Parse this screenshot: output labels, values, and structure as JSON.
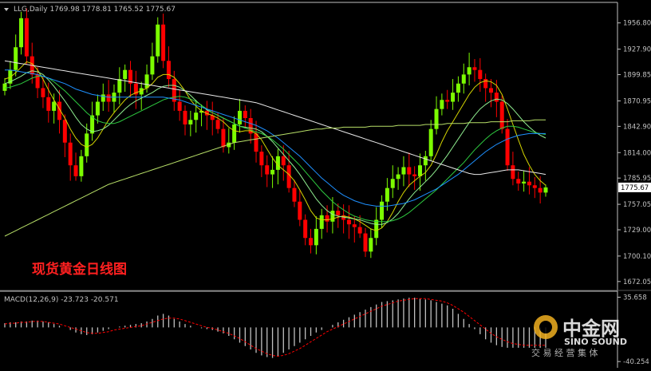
{
  "header": {
    "symbol_line": "LLG,Daily  1769.98 1778.81 1765.52 1775.67"
  },
  "annotation": "现货黄金日线图",
  "watermark": {
    "brand": "中金网",
    "brand_latin": "SINO SOUND",
    "slogan": "交 易 经 营  集 体"
  },
  "colors": {
    "background": "#000000",
    "axis": "#c0c0c0",
    "bull": "#7cfc00",
    "bear": "#ff0000",
    "ma_fast": "#d4d400",
    "ma_mid1": "#90ee90",
    "ma_mid2": "#2ecc40",
    "ma_blue": "#1e90ff",
    "ma_white": "#e8e8e8",
    "ma_long": "#b8e068",
    "macd_hist": "#c0c0c0",
    "macd_signal": "#ff0000",
    "annotation": "#ff2020"
  },
  "chart_data": [
    {
      "type": "line",
      "title": "",
      "price_axis_ticks": [
        1956.8,
        1927.9,
        1899.85,
        1870.95,
        1842.9,
        1814.0,
        1785.95,
        1757.05,
        1729.0,
        1700.1,
        1672.05
      ],
      "ylim": [
        1664,
        1975
      ],
      "current_price": 1775.67,
      "last_bar": {
        "open": 1769.98,
        "high": 1778.81,
        "low": 1765.52,
        "close": 1775.67
      },
      "close_path": [
        1890,
        1905,
        1930,
        1962,
        1920,
        1900,
        1885,
        1875,
        1860,
        1870,
        1850,
        1825,
        1800,
        1788,
        1810,
        1835,
        1855,
        1870,
        1878,
        1870,
        1880,
        1895,
        1905,
        1890,
        1878,
        1885,
        1900,
        1920,
        1955,
        1915,
        1895,
        1870,
        1860,
        1845,
        1850,
        1858,
        1860,
        1855,
        1850,
        1840,
        1820,
        1825,
        1845,
        1860,
        1852,
        1835,
        1815,
        1800,
        1790,
        1795,
        1810,
        1800,
        1775,
        1760,
        1740,
        1720,
        1712,
        1730,
        1745,
        1738,
        1750,
        1745,
        1740,
        1735,
        1732,
        1725,
        1705,
        1720,
        1740,
        1760,
        1775,
        1785,
        1790,
        1798,
        1790,
        1788,
        1800,
        1810,
        1840,
        1862,
        1872,
        1870,
        1880,
        1890,
        1900,
        1908,
        1905,
        1895,
        1885,
        1880,
        1870,
        1840,
        1800,
        1785,
        1780,
        1782,
        1778,
        1775,
        1770,
        1775
      ],
      "series": [
        {
          "key": "ma_fast",
          "values": [
            1895,
            1897,
            1902,
            1908,
            1914,
            1912,
            1905,
            1895,
            1883,
            1872,
            1862,
            1852,
            1840,
            1830,
            1823,
            1820,
            1823,
            1830,
            1840,
            1850,
            1858,
            1865,
            1872,
            1877,
            1880,
            1882,
            1885,
            1890,
            1897,
            1900,
            1900,
            1897,
            1890,
            1882,
            1872,
            1865,
            1860,
            1857,
            1855,
            1852,
            1848,
            1842,
            1838,
            1837,
            1838,
            1838,
            1835,
            1828,
            1818,
            1808,
            1800,
            1795,
            1790,
            1783,
            1773,
            1762,
            1750,
            1742,
            1740,
            1740,
            1741,
            1743,
            1744,
            1743,
            1741,
            1738,
            1734,
            1730,
            1728,
            1731,
            1738,
            1748,
            1760,
            1770,
            1778,
            1783,
            1788,
            1792,
            1800,
            1812,
            1826,
            1838,
            1848,
            1858,
            1868,
            1878,
            1886,
            1891,
            1893,
            1892,
            1888,
            1878,
            1862,
            1845,
            1828,
            1812,
            1800,
            1790,
            1783,
            1778
          ]
        },
        {
          "key": "ma_mid1",
          "values": [
            1890,
            1892,
            1895,
            1898,
            1902,
            1904,
            1903,
            1900,
            1894,
            1887,
            1879,
            1871,
            1862,
            1853,
            1845,
            1840,
            1837,
            1838,
            1840,
            1844,
            1850,
            1856,
            1862,
            1867,
            1871,
            1874,
            1877,
            1880,
            1884,
            1887,
            1888,
            1888,
            1886,
            1882,
            1877,
            1871,
            1866,
            1861,
            1858,
            1855,
            1852,
            1849,
            1846,
            1843,
            1842,
            1841,
            1840,
            1837,
            1832,
            1826,
            1819,
            1812,
            1805,
            1798,
            1790,
            1781,
            1772,
            1763,
            1756,
            1750,
            1746,
            1744,
            1743,
            1742,
            1741,
            1740,
            1738,
            1736,
            1735,
            1735,
            1737,
            1741,
            1747,
            1755,
            1763,
            1770,
            1776,
            1782,
            1788,
            1795,
            1803,
            1811,
            1820,
            1829,
            1838,
            1847,
            1855,
            1862,
            1867,
            1871,
            1873,
            1872,
            1868,
            1862,
            1855,
            1848,
            1842,
            1837,
            1833,
            1830
          ]
        },
        {
          "key": "ma_mid2",
          "values": [
            1885,
            1886,
            1888,
            1890,
            1893,
            1896,
            1898,
            1898,
            1896,
            1892,
            1887,
            1882,
            1876,
            1870,
            1864,
            1858,
            1853,
            1849,
            1847,
            1846,
            1846,
            1848,
            1851,
            1854,
            1857,
            1860,
            1863,
            1866,
            1869,
            1872,
            1874,
            1875,
            1876,
            1875,
            1873,
            1870,
            1866,
            1862,
            1858,
            1855,
            1852,
            1849,
            1846,
            1843,
            1841,
            1839,
            1837,
            1835,
            1832,
            1828,
            1823,
            1818,
            1812,
            1806,
            1800,
            1793,
            1786,
            1779,
            1772,
            1766,
            1760,
            1755,
            1751,
            1747,
            1744,
            1742,
            1740,
            1739,
            1738,
            1738,
            1738,
            1739,
            1741,
            1744,
            1748,
            1753,
            1758,
            1763,
            1768,
            1773,
            1779,
            1785,
            1791,
            1797,
            1803,
            1810,
            1817,
            1823,
            1829,
            1834,
            1838,
            1841,
            1843,
            1843,
            1842,
            1840,
            1838,
            1836,
            1835,
            1834
          ]
        },
        {
          "key": "ma_blue",
          "values": [
            1905,
            1905,
            1904,
            1903,
            1902,
            1901,
            1900,
            1898,
            1896,
            1894,
            1892,
            1890,
            1887,
            1884,
            1882,
            1880,
            1878,
            1877,
            1876,
            1875,
            1875,
            1875,
            1875,
            1875,
            1875,
            1875,
            1875,
            1875,
            1875,
            1875,
            1874,
            1873,
            1872,
            1870,
            1868,
            1866,
            1864,
            1862,
            1860,
            1858,
            1856,
            1854,
            1852,
            1850,
            1848,
            1846,
            1844,
            1841,
            1838,
            1834,
            1830,
            1825,
            1820,
            1815,
            1810,
            1804,
            1798,
            1792,
            1786,
            1781,
            1776,
            1771,
            1767,
            1764,
            1761,
            1759,
            1757,
            1756,
            1755,
            1755,
            1755,
            1756,
            1757,
            1758,
            1760,
            1762,
            1765,
            1768,
            1771,
            1774,
            1778,
            1782,
            1786,
            1790,
            1795,
            1800,
            1805,
            1810,
            1815,
            1819,
            1823,
            1826,
            1829,
            1831,
            1833,
            1834,
            1835,
            1835,
            1835,
            1835
          ]
        },
        {
          "key": "ma_white",
          "values": [
            1915,
            1914,
            1913,
            1912,
            1911,
            1910,
            1909,
            1908,
            1907,
            1906,
            1905,
            1904,
            1903,
            1902,
            1901,
            1900,
            1899,
            1898,
            1897,
            1896,
            1895,
            1894,
            1893,
            1892,
            1891,
            1890,
            1889,
            1888,
            1887,
            1886,
            1885,
            1884,
            1883,
            1882,
            1881,
            1880,
            1879,
            1878,
            1877,
            1876,
            1875,
            1874,
            1873,
            1872,
            1871,
            1870,
            1869,
            1867,
            1865,
            1863,
            1861,
            1859,
            1857,
            1855,
            1853,
            1851,
            1849,
            1847,
            1845,
            1843,
            1841,
            1839,
            1837,
            1835,
            1833,
            1831,
            1829,
            1827,
            1825,
            1823,
            1821,
            1819,
            1817,
            1815,
            1813,
            1811,
            1809,
            1807,
            1805,
            1803,
            1801,
            1799,
            1797,
            1795,
            1793,
            1791,
            1790,
            1790,
            1791,
            1792,
            1793,
            1794,
            1795,
            1795,
            1795,
            1794,
            1793,
            1792,
            1791,
            1790
          ]
        },
        {
          "key": "ma_long",
          "values": [
            1722,
            1725,
            1728,
            1731,
            1734,
            1737,
            1740,
            1743,
            1746,
            1749,
            1752,
            1755,
            1758,
            1761,
            1764,
            1767,
            1770,
            1773,
            1776,
            1779,
            1781,
            1783,
            1785,
            1787,
            1789,
            1791,
            1793,
            1795,
            1797,
            1799,
            1801,
            1803,
            1805,
            1807,
            1809,
            1811,
            1813,
            1815,
            1817,
            1819,
            1821,
            1823,
            1825,
            1826,
            1827,
            1828,
            1829,
            1830,
            1831,
            1832,
            1833,
            1834,
            1835,
            1836,
            1837,
            1838,
            1839,
            1840,
            1840,
            1841,
            1841,
            1841,
            1842,
            1842,
            1842,
            1842,
            1842,
            1843,
            1843,
            1843,
            1843,
            1843,
            1844,
            1844,
            1844,
            1844,
            1844,
            1845,
            1845,
            1845,
            1845,
            1846,
            1846,
            1846,
            1846,
            1847,
            1847,
            1847,
            1847,
            1848,
            1848,
            1848,
            1848,
            1849,
            1849,
            1849,
            1849,
            1850,
            1850,
            1850
          ]
        }
      ]
    },
    {
      "type": "bar",
      "title": "MACD(12,26,9) -23.723 -20.571",
      "axis_ticks": [
        35.658,
        -40.254
      ],
      "ylim": [
        -42,
        38
      ],
      "histogram": [
        5,
        6,
        6,
        7,
        7,
        8,
        8,
        7,
        6,
        4,
        2,
        0,
        -3,
        -6,
        -8,
        -9,
        -8,
        -6,
        -4,
        -2,
        0,
        1,
        2,
        3,
        4,
        5,
        7,
        10,
        14,
        16,
        14,
        10,
        7,
        4,
        2,
        0,
        -1,
        -2,
        -3,
        -5,
        -7,
        -10,
        -14,
        -18,
        -22,
        -26,
        -30,
        -33,
        -35,
        -36,
        -34,
        -30,
        -26,
        -22,
        -18,
        -14,
        -10,
        -6,
        -3,
        0,
        3,
        6,
        9,
        12,
        15,
        18,
        21,
        24,
        27,
        30,
        31,
        32,
        33,
        34,
        35,
        35,
        34,
        33,
        32,
        30,
        28,
        26,
        22,
        16,
        10,
        4,
        -2,
        -8,
        -14,
        -18,
        -21,
        -23,
        -24,
        -24,
        -24,
        -24,
        -24,
        -24,
        -24,
        -24
      ],
      "signal": [
        4,
        5,
        5,
        6,
        6,
        7,
        7,
        7,
        6,
        5,
        4,
        2,
        0,
        -2,
        -4,
        -6,
        -7,
        -7,
        -6,
        -5,
        -3,
        -2,
        -1,
        0,
        1,
        2,
        4,
        6,
        8,
        10,
        11,
        11,
        10,
        8,
        6,
        4,
        2,
        0,
        -1,
        -3,
        -5,
        -7,
        -10,
        -13,
        -17,
        -21,
        -25,
        -28,
        -31,
        -33,
        -34,
        -33,
        -31,
        -28,
        -25,
        -21,
        -17,
        -13,
        -9,
        -5,
        -2,
        1,
        4,
        7,
        10,
        13,
        16,
        19,
        22,
        25,
        27,
        29,
        31,
        32,
        33,
        34,
        34,
        34,
        33,
        32,
        31,
        29,
        26,
        22,
        18,
        13,
        8,
        3,
        -2,
        -7,
        -11,
        -14,
        -17,
        -19,
        -20,
        -21,
        -21,
        -21,
        -21,
        -21
      ]
    }
  ]
}
